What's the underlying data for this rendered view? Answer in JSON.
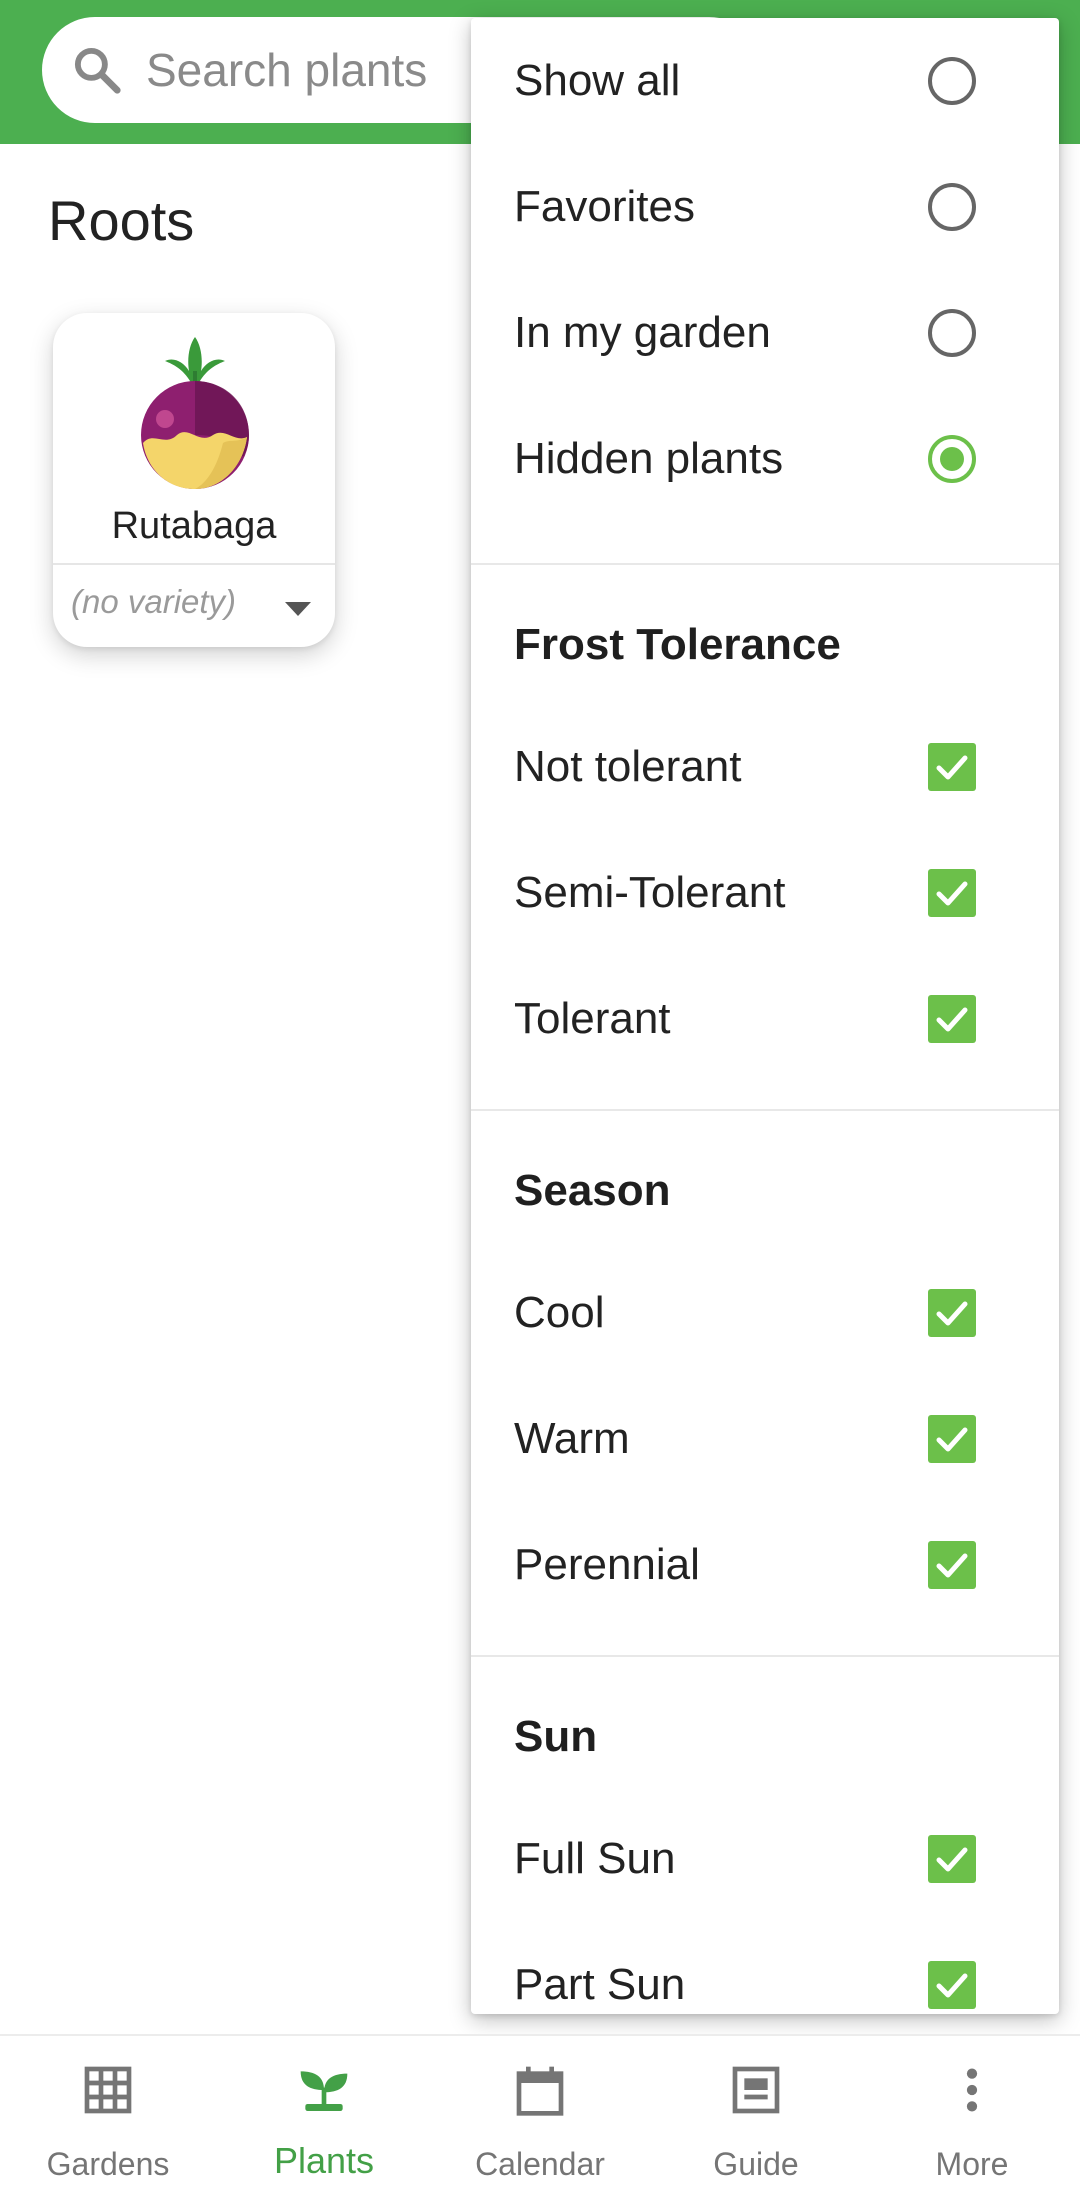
{
  "search": {
    "placeholder": "Search plants"
  },
  "section_title": "Roots",
  "plant_card": {
    "name": "Rutabaga",
    "variety": "(no variety)"
  },
  "filter_menu": {
    "show": [
      {
        "label": "Show all",
        "selected": false
      },
      {
        "label": "Favorites",
        "selected": false
      },
      {
        "label": "In my garden",
        "selected": false
      },
      {
        "label": "Hidden plants",
        "selected": true
      }
    ],
    "frost_header": "Frost Tolerance",
    "frost": [
      {
        "label": "Not tolerant",
        "checked": true
      },
      {
        "label": "Semi-Tolerant",
        "checked": true
      },
      {
        "label": "Tolerant",
        "checked": true
      }
    ],
    "season_header": "Season",
    "season": [
      {
        "label": "Cool",
        "checked": true
      },
      {
        "label": "Warm",
        "checked": true
      },
      {
        "label": "Perennial",
        "checked": true
      }
    ],
    "sun_header": "Sun",
    "sun": [
      {
        "label": "Full Sun",
        "checked": true
      },
      {
        "label": "Part Sun",
        "checked": true
      }
    ]
  },
  "bottom_nav": [
    {
      "label": "Gardens",
      "icon": "grid-icon",
      "active": false
    },
    {
      "label": "Plants",
      "icon": "sprout-icon",
      "active": true
    },
    {
      "label": "Calendar",
      "icon": "calendar-icon",
      "active": false
    },
    {
      "label": "Guide",
      "icon": "guide-icon",
      "active": false
    },
    {
      "label": "More",
      "icon": "more-vert-icon",
      "active": false
    }
  ],
  "colors": {
    "brand_green": "#4caf50",
    "accent_green": "#6cc04a",
    "nav_active": "#43a047"
  }
}
